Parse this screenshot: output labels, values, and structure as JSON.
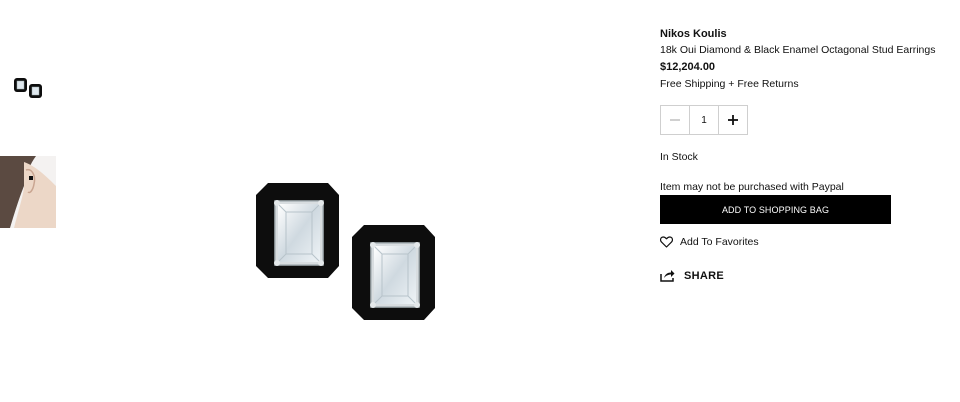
{
  "thumbnails": [
    {
      "name": "earrings-pair-thumbnail"
    },
    {
      "name": "model-ear-thumbnail"
    }
  ],
  "product": {
    "brand": "Nikos Koulis",
    "name": "18k Oui Diamond & Black Enamel Octagonal Stud Earrings",
    "price": "$12,204.00",
    "shipping": "Free Shipping + Free Returns"
  },
  "quantity": {
    "value": "1",
    "minus_icon": "minus-icon",
    "plus_icon": "plus-icon"
  },
  "stock_status": "In Stock",
  "paypal_notice": "Item may not be purchased with Paypal",
  "add_to_bag_label": "ADD TO SHOPPING BAG",
  "favorites": {
    "label": "Add To Favorites",
    "icon": "heart-icon"
  },
  "share": {
    "label": "SHARE",
    "icon": "share-icon"
  },
  "colors": {
    "accent": "#000000",
    "border": "#cfcfcf",
    "enamel": "#0d0d0d",
    "diamond": "#dfe8ee"
  }
}
